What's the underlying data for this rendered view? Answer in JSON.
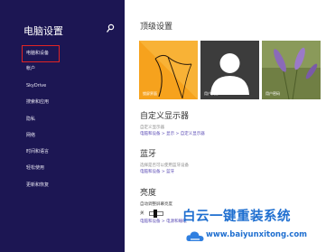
{
  "sidebar": {
    "title": "电脑设置",
    "search_icon": "search-icon",
    "items": [
      {
        "label": "电脑和设备"
      },
      {
        "label": "帐户"
      },
      {
        "label": "SkyDrive"
      },
      {
        "label": "搜索和应用"
      },
      {
        "label": "隐私"
      },
      {
        "label": "网络"
      },
      {
        "label": "时间和语言"
      },
      {
        "label": "轻松使用"
      },
      {
        "label": "更新和恢复"
      }
    ],
    "highlight_color": "#e02424"
  },
  "main": {
    "top_settings": {
      "heading": "顶级设置",
      "tiles": [
        {
          "label": "锁屏界面",
          "color": "#f5a623"
        },
        {
          "label": "用户头像",
          "color": "#3c3c3c"
        },
        {
          "label": "用户密码",
          "color": "#7a8a48"
        }
      ]
    },
    "display": {
      "heading": "自定义显示器",
      "description": "自定义显示器",
      "breadcrumb": "电脑和设备 > 显示 > 自定义显示器"
    },
    "bluetooth": {
      "heading": "蓝牙",
      "description": "选择是否可以使用蓝牙设备",
      "breadcrumb": "电脑和设备 > 蓝牙"
    },
    "brightness": {
      "heading": "亮度",
      "description": "自动调整屏幕亮度",
      "toggle_label": "关",
      "breadcrumb": "电脑和设备 > 电源和睡眠"
    }
  },
  "watermark": {
    "text": "白云一键重装系统",
    "url": "www.baiyunxitong.com"
  }
}
